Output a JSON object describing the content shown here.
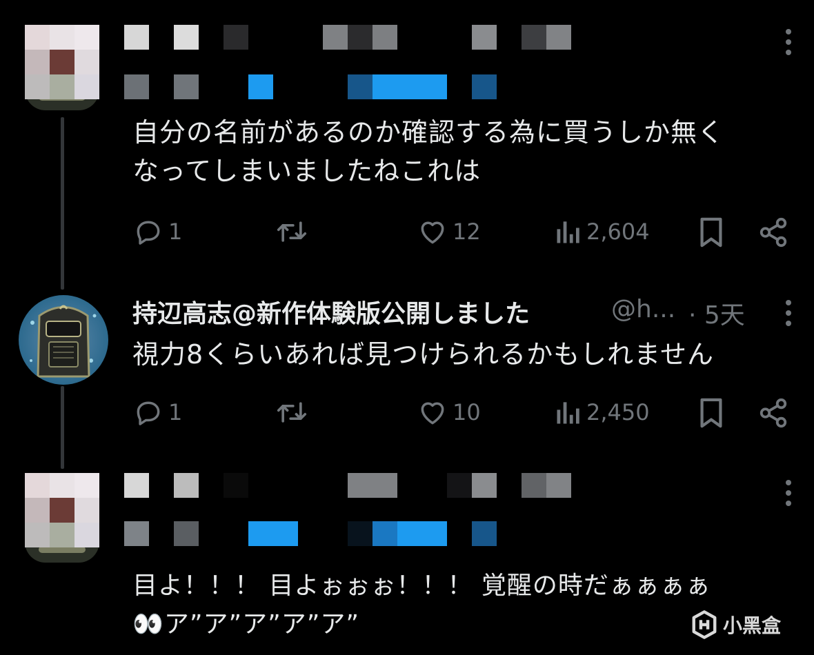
{
  "tweets": [
    {
      "text_lines": [
        "自分の名前があるのか確認する為に買うしか無く",
        "なってしまいましたねこれは"
      ],
      "stats": {
        "replies": "1",
        "reposts": "",
        "likes": "12",
        "views": "2,604"
      }
    },
    {
      "name": "持辺高志@新作体験版公開しました",
      "handle": "@h...",
      "time": "· 5天",
      "text_lines": [
        "視力8くらいあれば見つけられるかもしれません"
      ],
      "stats": {
        "replies": "1",
        "reposts": "",
        "likes": "10",
        "views": "2,450"
      }
    },
    {
      "text_lines": [
        "目よ！！！ 目よぉぉぉ！！！ 覚醒の時だぁぁぁぁ",
        "👀ア”ア”ア”ア”ア”"
      ]
    }
  ],
  "watermark": {
    "text": "小黑盒"
  },
  "icons": [
    "reply-icon",
    "repost-icon",
    "like-icon",
    "views-icon",
    "bookmark-icon",
    "share-icon",
    "more-icon"
  ],
  "colors": {
    "background": "#000000",
    "text": "#e7e9ea",
    "muted": "#71767b",
    "accent": "#1d9bf0"
  }
}
